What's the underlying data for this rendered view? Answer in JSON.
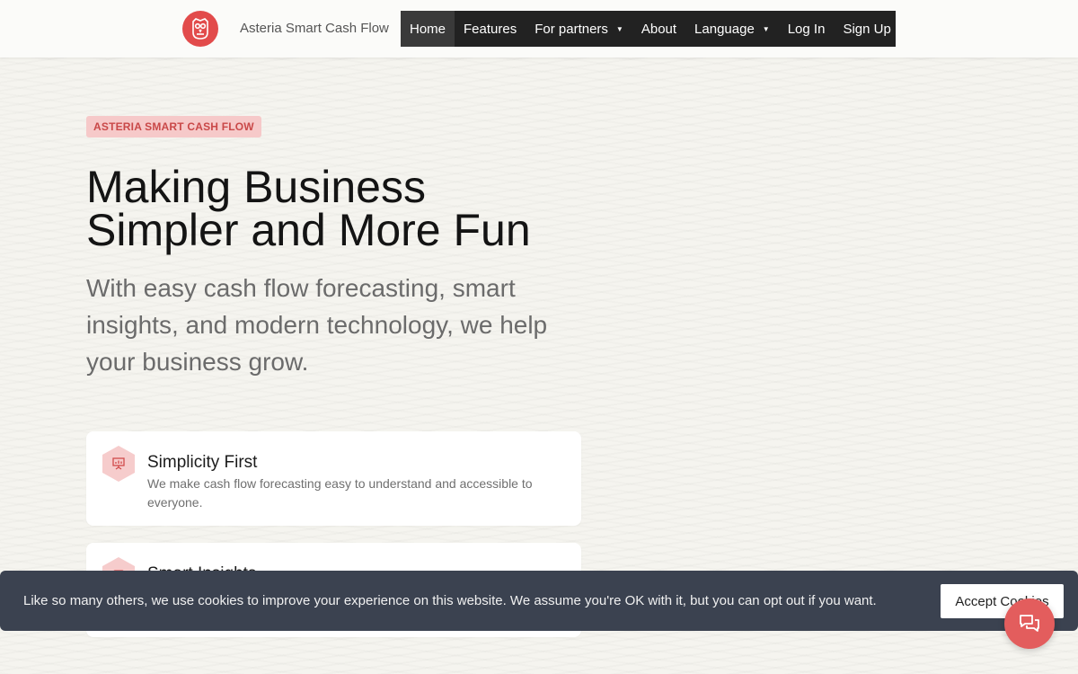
{
  "header": {
    "brand": "Asteria Smart Cash Flow",
    "logo_icon": "owl-icon",
    "nav": [
      {
        "label": "Home",
        "active": true
      },
      {
        "label": "Features"
      },
      {
        "label": "For partners",
        "dropdown": true
      },
      {
        "label": "About"
      },
      {
        "label": "Language",
        "dropdown": true
      },
      {
        "label": "Log In"
      },
      {
        "label": "Sign Up"
      }
    ]
  },
  "hero": {
    "eyebrow": "ASTERIA SMART CASH FLOW",
    "headline_line1": "Making Business",
    "headline_line2": "Simpler and More Fun",
    "subheadline": "With easy cash flow forecasting, smart insights, and modern technology, we help your business grow."
  },
  "features": [
    {
      "icon": "presentation-icon",
      "title": "Simplicity First",
      "description": "We make cash flow forecasting easy to understand and accessible to everyone."
    },
    {
      "icon": "insight-icon",
      "title": "Smart Insights",
      "description": ""
    }
  ],
  "cookie_banner": {
    "text": "Like so many others, we use cookies to improve your experience on this website. We assume you're OK with it, but you can opt out if you want.",
    "accept_label": "Accept Cookies"
  },
  "chat": {
    "icon": "chat-icon"
  },
  "colors": {
    "accent": "#e24b4b",
    "nav_bg": "#222222",
    "cookie_bg": "#3b4250"
  }
}
